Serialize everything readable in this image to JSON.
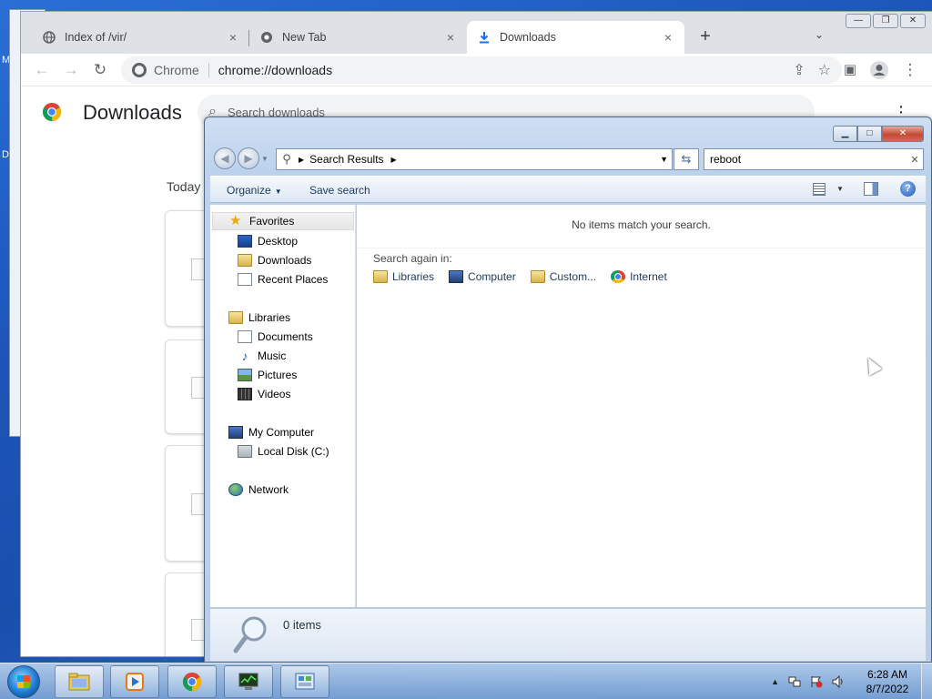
{
  "chrome": {
    "tabs": [
      {
        "label": "Index of /vir/",
        "icon": "globe-icon",
        "close": "×"
      },
      {
        "label": "New Tab",
        "icon": "chrome-icon",
        "close": "×"
      },
      {
        "label": "Downloads",
        "icon": "download-icon",
        "close": "×"
      }
    ],
    "new_tab": "+",
    "tab_list": "⌄",
    "omnibox": {
      "chip": "Chrome",
      "url": "chrome://downloads"
    },
    "page": {
      "title": "Downloads",
      "search_placeholder": "Search downloads",
      "section": "Today",
      "menu": "⋮"
    }
  },
  "explorer": {
    "breadcrumb": "Search Results",
    "search_value": "reboot",
    "commands": {
      "organize": "Organize",
      "save_search": "Save search"
    },
    "nav": {
      "favorites": "Favorites",
      "desktop": "Desktop",
      "downloads": "Downloads",
      "recent": "Recent Places",
      "libraries": "Libraries",
      "documents": "Documents",
      "music": "Music",
      "pictures": "Pictures",
      "videos": "Videos",
      "computer": "My Computer",
      "local_disk": "Local Disk (C:)",
      "network": "Network"
    },
    "content": {
      "no_items": "No items match your search.",
      "search_again": "Search again in:",
      "links": [
        "Libraries",
        "Computer",
        "Custom...",
        "Internet"
      ]
    },
    "details": {
      "count": "0 items"
    }
  },
  "taskbar": {
    "clock": {
      "time": "6:28 AM",
      "date": "8/7/2022"
    }
  },
  "desktop": {
    "frag1": "M",
    "frag2": "D"
  }
}
